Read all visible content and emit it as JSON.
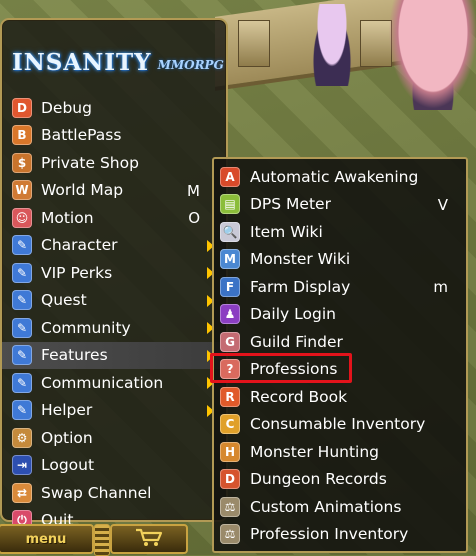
{
  "logo": {
    "name": "INSANITY",
    "suffix": "MMORPG"
  },
  "main_menu": [
    {
      "label": "Debug",
      "icon": "debug-icon",
      "color": "#e0572f",
      "glyph": "D"
    },
    {
      "label": "BattlePass",
      "icon": "battlepass-icon",
      "color": "#d9772a",
      "glyph": "B"
    },
    {
      "label": "Private Shop",
      "icon": "private-shop-icon",
      "color": "#c9742c",
      "glyph": "$"
    },
    {
      "label": "World Map",
      "icon": "world-map-icon",
      "color": "#d07a34",
      "glyph": "W",
      "hotkey": "M"
    },
    {
      "label": "Motion",
      "icon": "motion-icon",
      "color": "#d9575b",
      "glyph": "☺",
      "hotkey": "O"
    },
    {
      "label": "Character",
      "icon": "character-icon",
      "color": "#3f79d6",
      "glyph": "✎",
      "submenu": true
    },
    {
      "label": "VIP Perks",
      "icon": "vip-perks-icon",
      "color": "#3f79d6",
      "glyph": "✎",
      "submenu": true
    },
    {
      "label": "Quest",
      "icon": "quest-icon",
      "color": "#3f79d6",
      "glyph": "✎",
      "submenu": true
    },
    {
      "label": "Community",
      "icon": "community-icon",
      "color": "#3f79d6",
      "glyph": "✎",
      "submenu": true
    },
    {
      "label": "Features",
      "icon": "features-icon",
      "color": "#3f79d6",
      "glyph": "✎",
      "submenu": true,
      "active": true
    },
    {
      "label": "Communication",
      "icon": "communication-icon",
      "color": "#3f79d6",
      "glyph": "✎",
      "submenu": true
    },
    {
      "label": "Helper",
      "icon": "helper-icon",
      "color": "#3f79d6",
      "glyph": "✎",
      "submenu": true
    },
    {
      "label": "Option",
      "icon": "option-gear-icon",
      "color": "#c58a3c",
      "glyph": "⚙"
    },
    {
      "label": "Logout",
      "icon": "logout-icon",
      "color": "#2d4fb0",
      "glyph": "⇥"
    },
    {
      "label": "Swap Channel",
      "icon": "swap-channel-icon",
      "color": "#d98a3a",
      "glyph": "⇄"
    },
    {
      "label": "Quit",
      "icon": "quit-icon",
      "color": "#d94a6a",
      "glyph": "⏻"
    }
  ],
  "features_submenu": [
    {
      "label": "Automatic Awakening",
      "icon": "automatic-awakening-icon",
      "color": "#d84a2a",
      "glyph": "A"
    },
    {
      "label": "DPS Meter",
      "icon": "dps-meter-icon",
      "color": "#8bbd3a",
      "glyph": "▤",
      "hotkey": "V"
    },
    {
      "label": "Item Wiki",
      "icon": "item-wiki-icon",
      "color": "#c9c9d6",
      "glyph": "🔍"
    },
    {
      "label": "Monster Wiki",
      "icon": "monster-wiki-icon",
      "color": "#4b88d2",
      "glyph": "M"
    },
    {
      "label": "Farm Display",
      "icon": "farm-display-icon",
      "color": "#3b73c6",
      "glyph": "F",
      "hotkey": "m"
    },
    {
      "label": "Daily Login",
      "icon": "daily-login-icon",
      "color": "#8b3ec2",
      "glyph": "♟"
    },
    {
      "label": "Guild Finder",
      "icon": "guild-finder-icon",
      "color": "#c46b72",
      "glyph": "G"
    },
    {
      "label": "Professions",
      "icon": "professions-icon",
      "color": "#d96a5e",
      "glyph": "?",
      "highlighted": true
    },
    {
      "label": "Record Book",
      "icon": "record-book-icon",
      "color": "#e05a2a",
      "glyph": "R"
    },
    {
      "label": "Consumable Inventory",
      "icon": "consumable-inventory-icon",
      "color": "#e0a02a",
      "glyph": "C"
    },
    {
      "label": "Monster Hunting",
      "icon": "monster-hunting-icon",
      "color": "#d6882e",
      "glyph": "H"
    },
    {
      "label": "Dungeon Records",
      "icon": "dungeon-records-icon",
      "color": "#d6542e",
      "glyph": "D"
    },
    {
      "label": "Custom Animations",
      "icon": "custom-animations-icon",
      "color": "#9a8a6a",
      "glyph": "⚖"
    },
    {
      "label": "Profession Inventory",
      "icon": "profession-inventory-icon",
      "color": "#9a8a6a",
      "glyph": "⚖"
    }
  ],
  "bottom_bar": {
    "menu_label": "menu",
    "shop_icon": "cart-icon"
  },
  "colors": {
    "panel_border": "#b29a55",
    "arrow": "#ffc400",
    "highlight": "#e3131b",
    "active_row": "#4d4d4d"
  }
}
